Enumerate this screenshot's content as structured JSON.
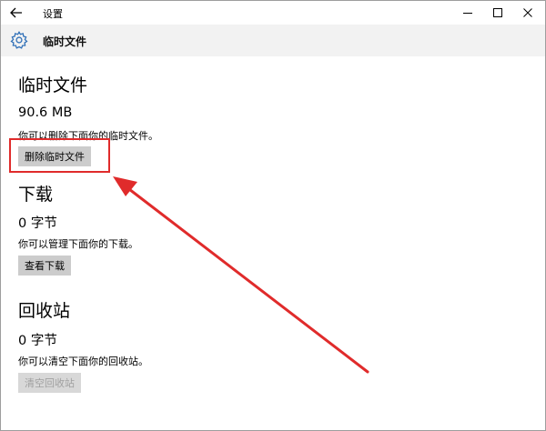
{
  "titlebar": {
    "app_title": "设置",
    "back_icon": "back-arrow-icon",
    "min_icon": "minimize-icon",
    "max_icon": "maximize-icon",
    "close_icon": "close-icon"
  },
  "header": {
    "icon": "gear-icon",
    "title": "临时文件",
    "accent": "#2f6fb7"
  },
  "sections": [
    {
      "title": "临时文件",
      "size": "90.6 MB",
      "description": "你可以删除下面你的临时文件。",
      "button": "删除临时文件",
      "enabled": true
    },
    {
      "title": "下载",
      "size": "0 字节",
      "description": "你可以管理下面你的下载。",
      "button": "查看下载",
      "enabled": true
    },
    {
      "title": "回收站",
      "size": "0 字节",
      "description": "你可以清空下面你的回收站。",
      "button": "清空回收站",
      "enabled": false
    }
  ],
  "annotation": {
    "color": "#e02b2b"
  }
}
